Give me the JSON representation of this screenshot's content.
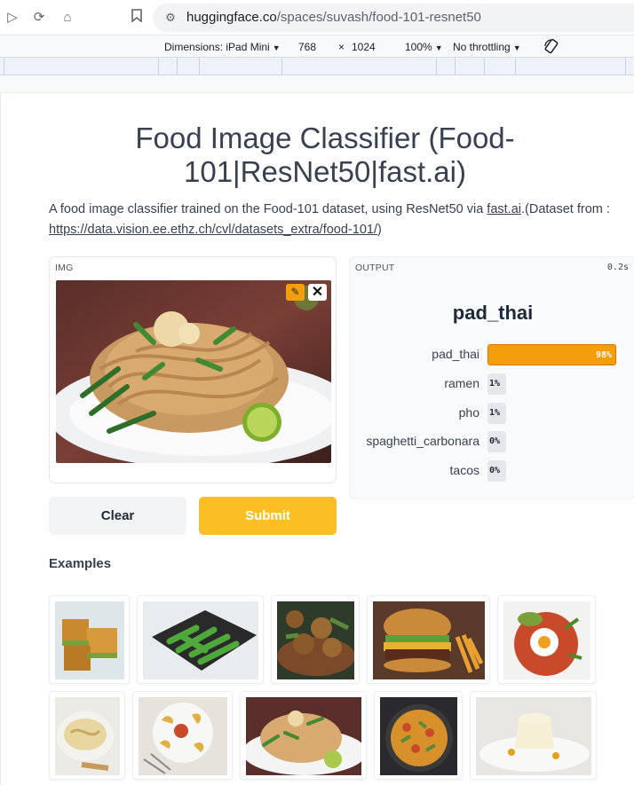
{
  "browser": {
    "url_host": "huggingface.co",
    "url_path": "/spaces/suvash/food-101-resnet50",
    "devtools": {
      "dimensions_label": "Dimensions: iPad Mini",
      "width": "768",
      "times": "×",
      "height": "1024",
      "zoom": "100%",
      "throttling": "No throttling"
    }
  },
  "app": {
    "title": "Food Image Classifier (Food-101|ResNet50|fast.ai)",
    "desc_pre": "A food image classifier trained on the Food-101 dataset, using ResNet50 via ",
    "desc_link1": "fast.ai",
    "desc_mid": ".(Dataset from : ",
    "desc_link2": "https://data.vision.ee.ethz.ch/cvl/datasets_extra/food-101/",
    "desc_post": ")",
    "input_label": "IMG",
    "output_label": "OUTPUT",
    "elapsed": "0.2s",
    "predicted": "pad_thai",
    "confidences": [
      {
        "label": "pad_thai",
        "value": "98%",
        "fraction": 0.98
      },
      {
        "label": "ramen",
        "value": "1%",
        "fraction": 0.01
      },
      {
        "label": "pho",
        "value": "1%",
        "fraction": 0.01
      },
      {
        "label": "spaghetti_carbonara",
        "value": "0%",
        "fraction": 0.0
      },
      {
        "label": "tacos",
        "value": "0%",
        "fraction": 0.0
      }
    ],
    "clear_label": "Clear",
    "submit_label": "Submit",
    "examples_title": "Examples",
    "examples": [
      "baklava",
      "edamame",
      "falafel",
      "hamburger",
      "huevos_rancheros",
      "hummus",
      "gyoza",
      "pad_thai",
      "paella",
      "panna_cotta"
    ]
  },
  "colors": {
    "accent": "#f59e0b",
    "submit": "#fbbf24",
    "text": "#374151"
  }
}
